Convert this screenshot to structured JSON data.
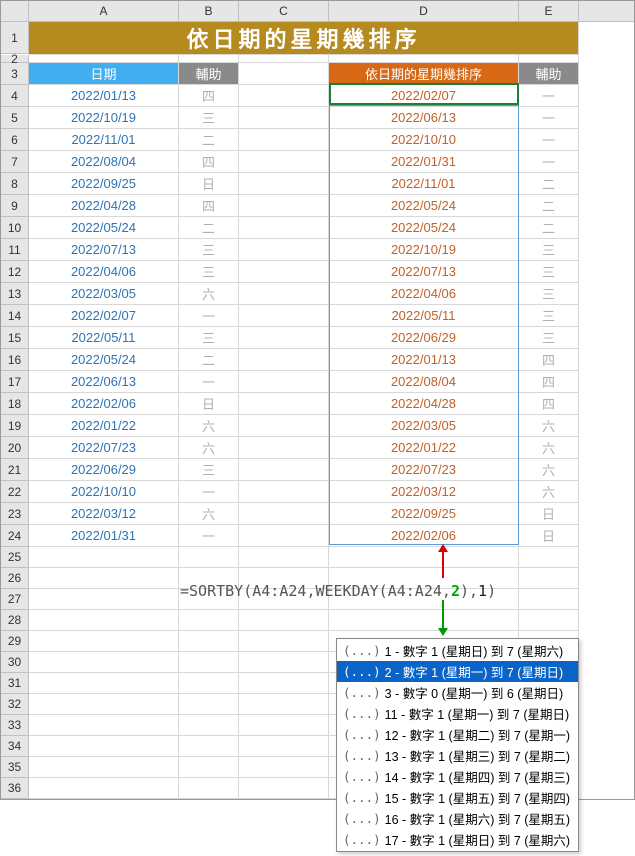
{
  "title": "依日期的星期幾排序",
  "cols": [
    "A",
    "B",
    "C",
    "D",
    "E"
  ],
  "hdrs": {
    "A": "日期",
    "B": "輔助",
    "D": "依日期的星期幾排序",
    "E": "輔助"
  },
  "rows": [
    {
      "r": 4,
      "a": "2022/01/13",
      "b": "四",
      "d": "2022/02/07",
      "e": "一"
    },
    {
      "r": 5,
      "a": "2022/10/19",
      "b": "三",
      "d": "2022/06/13",
      "e": "一"
    },
    {
      "r": 6,
      "a": "2022/11/01",
      "b": "二",
      "d": "2022/10/10",
      "e": "一"
    },
    {
      "r": 7,
      "a": "2022/08/04",
      "b": "四",
      "d": "2022/01/31",
      "e": "一"
    },
    {
      "r": 8,
      "a": "2022/09/25",
      "b": "日",
      "d": "2022/11/01",
      "e": "二"
    },
    {
      "r": 9,
      "a": "2022/04/28",
      "b": "四",
      "d": "2022/05/24",
      "e": "二"
    },
    {
      "r": 10,
      "a": "2022/05/24",
      "b": "二",
      "d": "2022/05/24",
      "e": "二"
    },
    {
      "r": 11,
      "a": "2022/07/13",
      "b": "三",
      "d": "2022/10/19",
      "e": "三"
    },
    {
      "r": 12,
      "a": "2022/04/06",
      "b": "三",
      "d": "2022/07/13",
      "e": "三"
    },
    {
      "r": 13,
      "a": "2022/03/05",
      "b": "六",
      "d": "2022/04/06",
      "e": "三"
    },
    {
      "r": 14,
      "a": "2022/02/07",
      "b": "一",
      "d": "2022/05/11",
      "e": "三"
    },
    {
      "r": 15,
      "a": "2022/05/11",
      "b": "三",
      "d": "2022/06/29",
      "e": "三"
    },
    {
      "r": 16,
      "a": "2022/05/24",
      "b": "二",
      "d": "2022/01/13",
      "e": "四"
    },
    {
      "r": 17,
      "a": "2022/06/13",
      "b": "一",
      "d": "2022/08/04",
      "e": "四"
    },
    {
      "r": 18,
      "a": "2022/02/06",
      "b": "日",
      "d": "2022/04/28",
      "e": "四"
    },
    {
      "r": 19,
      "a": "2022/01/22",
      "b": "六",
      "d": "2022/03/05",
      "e": "六"
    },
    {
      "r": 20,
      "a": "2022/07/23",
      "b": "六",
      "d": "2022/01/22",
      "e": "六"
    },
    {
      "r": 21,
      "a": "2022/06/29",
      "b": "三",
      "d": "2022/07/23",
      "e": "六"
    },
    {
      "r": 22,
      "a": "2022/10/10",
      "b": "一",
      "d": "2022/03/12",
      "e": "六"
    },
    {
      "r": 23,
      "a": "2022/03/12",
      "b": "六",
      "d": "2022/09/25",
      "e": "日"
    },
    {
      "r": 24,
      "a": "2022/01/31",
      "b": "一",
      "d": "2022/02/06",
      "e": "日"
    }
  ],
  "formula": {
    "prefix": "=SORTBY(",
    "ref1": "A4:A24",
    "mid1": ",WEEKDAY(",
    "ref2": "A4:A24",
    "mid2": ",",
    "arg2": "2",
    "mid3": "),",
    "argN": "1",
    "close": ")"
  },
  "tooltip": [
    "1 - 數字 1 (星期日) 到 7 (星期六)",
    "2 - 數字 1 (星期一) 到 7 (星期日)",
    "3 - 數字 0 (星期一) 到 6 (星期日)",
    "11 - 數字 1 (星期一) 到 7 (星期日)",
    "12 - 數字 1 (星期二) 到 7 (星期一)",
    "13 - 數字 1 (星期三) 到 7 (星期二)",
    "14 - 數字 1 (星期四) 到 7 (星期三)",
    "15 - 數字 1 (星期五) 到 7 (星期四)",
    "16 - 數字 1 (星期六) 到 7 (星期五)",
    "17 - 數字 1 (星期日) 到 7 (星期六)"
  ],
  "tooltip_selected": 1,
  "tooltip_icon": "(...)"
}
